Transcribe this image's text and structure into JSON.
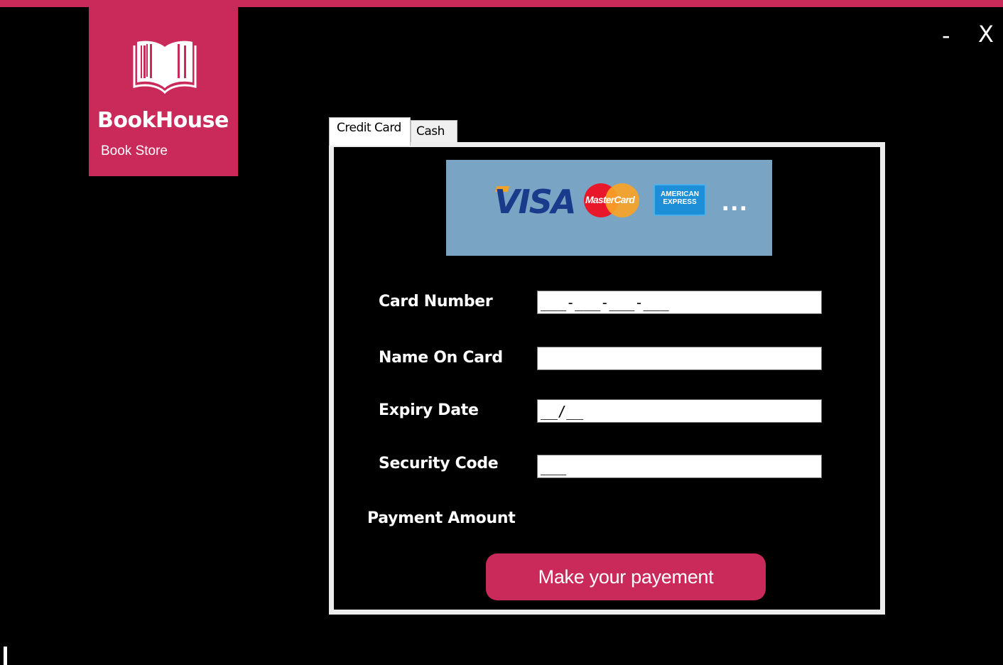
{
  "window": {
    "minimize_label": "-",
    "close_label": "X"
  },
  "brand": {
    "name": "BookHouse",
    "subtitle": "Book Store",
    "icon": "open-book-icon"
  },
  "tabs": [
    {
      "label": "Credit Card",
      "selected": true
    },
    {
      "label": "Cash",
      "selected": false
    }
  ],
  "card_logos": {
    "visa": "VISA",
    "mastercard": "MasterCard",
    "amex": "AMERICAN EXPRESS",
    "more": "..."
  },
  "form": {
    "card_number": {
      "label": "Card Number",
      "value": "___-___-___-___"
    },
    "name_on_card": {
      "label": "Name On Card",
      "value": ""
    },
    "expiry_date": {
      "label": "Expiry Date",
      "value": "__/__"
    },
    "security_code": {
      "label": "Security Code",
      "value": "___"
    },
    "payment_amount": {
      "label": "Payment Amount"
    }
  },
  "pay_button": {
    "label": "Make your payement"
  },
  "colors": {
    "accent": "#c92a5a",
    "background": "#000000",
    "banner": "#7aa4c4"
  }
}
